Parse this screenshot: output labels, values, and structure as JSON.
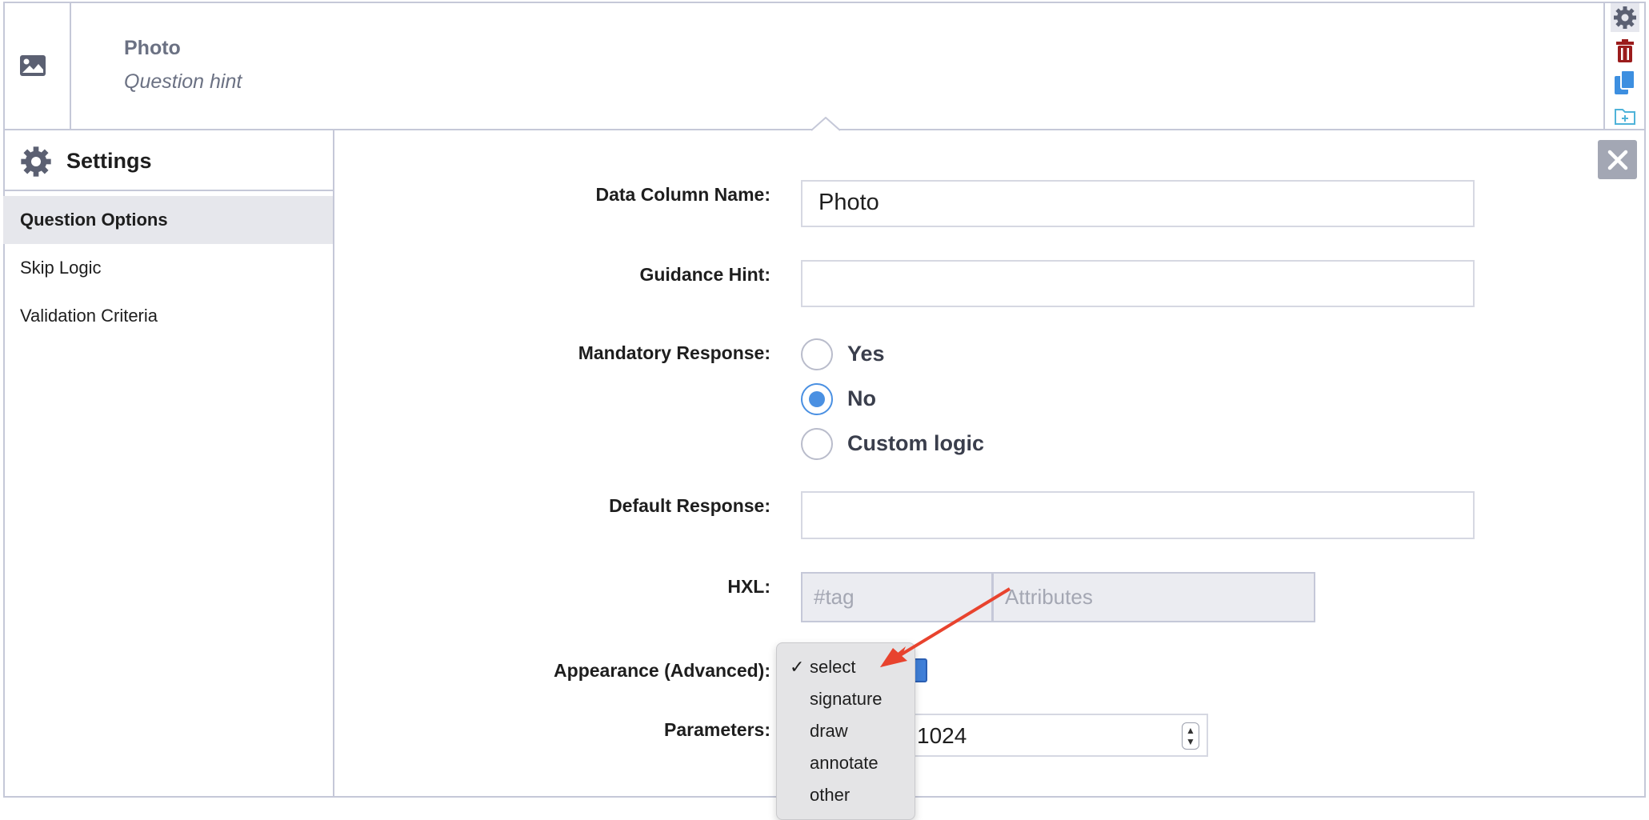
{
  "header": {
    "question_label": "Photo",
    "question_hint": "Question hint",
    "icons": {
      "question_type": "image-icon",
      "settings": "gear-icon",
      "delete": "trash-icon",
      "duplicate": "copy-icon",
      "add_to_library": "folder-plus-icon"
    }
  },
  "sidebar": {
    "title": "Settings",
    "items": [
      {
        "label": "Question Options",
        "active": true
      },
      {
        "label": "Skip Logic",
        "active": false
      },
      {
        "label": "Validation Criteria",
        "active": false
      }
    ]
  },
  "form": {
    "data_column_name": {
      "label": "Data Column Name:",
      "value": "Photo"
    },
    "guidance_hint": {
      "label": "Guidance Hint:",
      "value": ""
    },
    "mandatory_response": {
      "label": "Mandatory Response:",
      "options": [
        {
          "label": "Yes",
          "selected": false
        },
        {
          "label": "No",
          "selected": true
        },
        {
          "label": "Custom logic",
          "selected": false
        }
      ]
    },
    "default_response": {
      "label": "Default Response:",
      "value": ""
    },
    "hxl": {
      "label": "HXL:",
      "tag_placeholder": "#tag",
      "attributes_placeholder": "Attributes"
    },
    "appearance": {
      "label": "Appearance (Advanced):",
      "options": [
        "select",
        "signature",
        "draw",
        "annotate",
        "other"
      ],
      "selected": "select",
      "checkmark": "✓"
    },
    "parameters": {
      "label": "Parameters:",
      "value": "1024"
    }
  },
  "colors": {
    "accent_blue": "#4a90e2",
    "border": "#c5c8d8",
    "delete_red": "#9b1c1c",
    "annotation_arrow": "#e8432e"
  }
}
